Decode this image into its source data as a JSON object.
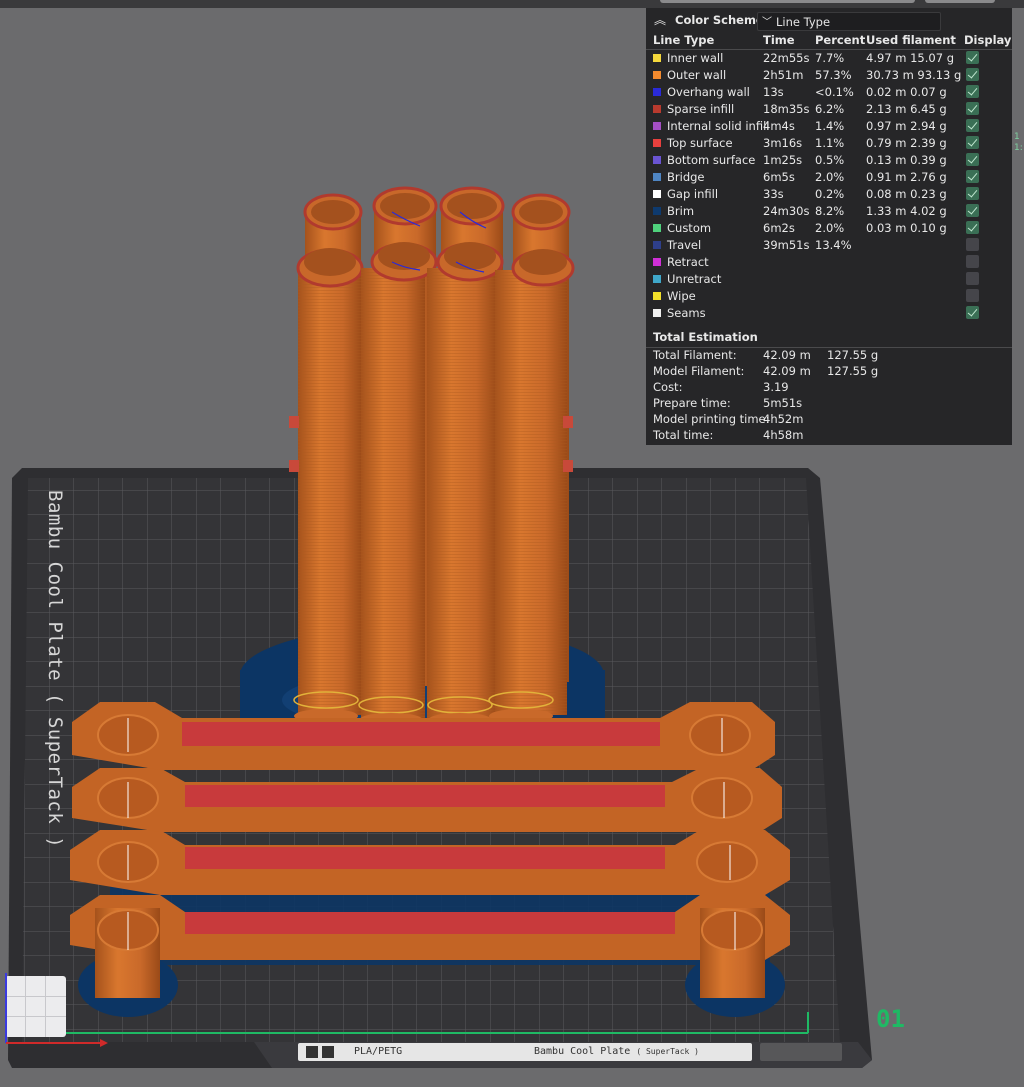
{
  "legend": {
    "title": "Color Scheme",
    "scheme_value": "Line Type",
    "columns": {
      "line_type": "Line Type",
      "time": "Time",
      "percent": "Percent",
      "used_filament": "Used filament",
      "display": "Display"
    },
    "rows": [
      {
        "name": "Inner wall",
        "color": "#f4d83c",
        "time": "22m55s",
        "percent": "7.7%",
        "used": "4.97 m   15.07 g",
        "display": true
      },
      {
        "name": "Outer wall",
        "color": "#f28a2e",
        "time": "2h51m",
        "percent": "57.3%",
        "used": "30.73 m  93.13 g",
        "display": true
      },
      {
        "name": "Overhang wall",
        "color": "#2a2ad8",
        "time": "13s",
        "percent": "<0.1%",
        "used": "0.02 m   0.07 g",
        "display": true
      },
      {
        "name": "Sparse infill",
        "color": "#b83a2e",
        "time": "18m35s",
        "percent": "6.2%",
        "used": "2.13 m   6.45 g",
        "display": true
      },
      {
        "name": "Internal solid infill",
        "color": "#a44fc4",
        "time": "4m4s",
        "percent": "1.4%",
        "used": "0.97 m   2.94 g",
        "display": true
      },
      {
        "name": "Top surface",
        "color": "#e8403e",
        "time": "3m16s",
        "percent": "1.1%",
        "used": "0.79 m   2.39 g",
        "display": true
      },
      {
        "name": "Bottom surface",
        "color": "#6a54d2",
        "time": "1m25s",
        "percent": "0.5%",
        "used": "0.13 m   0.39 g",
        "display": true
      },
      {
        "name": "Bridge",
        "color": "#4f86c4",
        "time": "6m5s",
        "percent": "2.0%",
        "used": "0.91 m   2.76 g",
        "display": true
      },
      {
        "name": "Gap infill",
        "color": "#ffffff",
        "time": "33s",
        "percent": "0.2%",
        "used": "0.08 m   0.23 g",
        "display": true
      },
      {
        "name": "Brim",
        "color": "#0e3a6e",
        "time": "24m30s",
        "percent": "8.2%",
        "used": "1.33 m   4.02 g",
        "display": true
      },
      {
        "name": "Custom",
        "color": "#4fd17c",
        "time": "6m2s",
        "percent": "2.0%",
        "used": "0.03 m   0.10 g",
        "display": true
      },
      {
        "name": "Travel",
        "color": "#2e3f8a",
        "time": "39m51s",
        "percent": "13.4%",
        "used": "",
        "display": false
      },
      {
        "name": "Retract",
        "color": "#d02fd6",
        "time": "",
        "percent": "",
        "used": "",
        "display": false
      },
      {
        "name": "Unretract",
        "color": "#3fa7c9",
        "time": "",
        "percent": "",
        "used": "",
        "display": false
      },
      {
        "name": "Wipe",
        "color": "#f2e02a",
        "time": "",
        "percent": "",
        "used": "",
        "display": false
      },
      {
        "name": "Seams",
        "color": "#f0f0f0",
        "time": "",
        "percent": "",
        "used": "",
        "display": true
      }
    ],
    "total_title": "Total Estimation",
    "totals": [
      {
        "label": "Total Filament:",
        "v1": "42.09 m",
        "v2": "127.55 g"
      },
      {
        "label": "Model Filament:",
        "v1": "42.09 m",
        "v2": "127.55 g"
      },
      {
        "label": "Cost:",
        "v1": "3.19",
        "v2": ""
      },
      {
        "label": "Prepare time:",
        "v1": "5m51s",
        "v2": ""
      },
      {
        "label": "Model printing time:",
        "v1": "4h52m",
        "v2": ""
      },
      {
        "label": "Total time:",
        "v1": "4h58m",
        "v2": ""
      }
    ]
  },
  "plate": {
    "label": "Bambu Cool Plate ( SuperTack )",
    "number": "01",
    "filament": "PLA/PETG",
    "plate_type": "Bambu Cool Plate",
    "plate_type_sub": "( SuperTack )"
  },
  "side_marks": "1\n1:"
}
